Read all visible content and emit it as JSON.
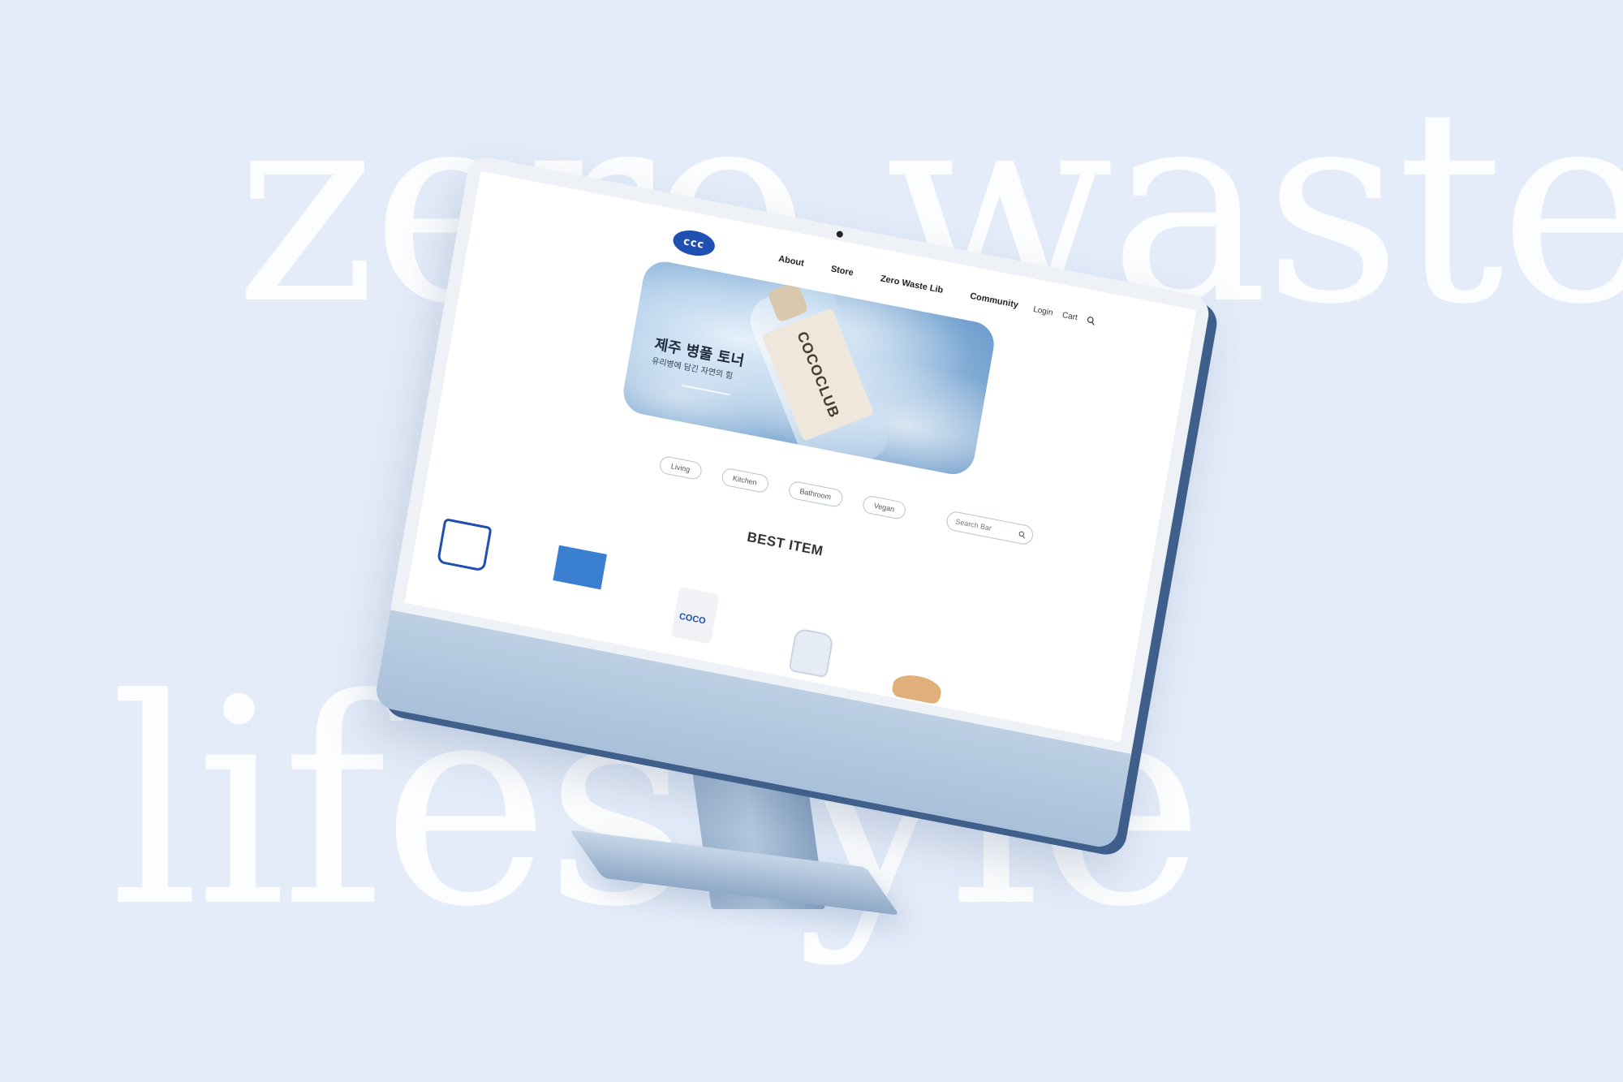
{
  "background": {
    "word_top": "zero waste",
    "word_bottom": "lifestyle"
  },
  "site": {
    "logo_text": "ccc",
    "brand_color": "#1f4fb0",
    "nav": {
      "about": "About",
      "store": "Store",
      "zero_waste_lib": "Zero Waste Lib",
      "community": "Community"
    },
    "util": {
      "login": "Login",
      "cart": "Cart",
      "search_icon": "search-icon"
    },
    "hero": {
      "title": "제주 병풀 토너",
      "subtitle": "유리병에 담긴 자연의 힘",
      "product_brand": "COCOCLUB"
    },
    "categories": [
      "Living",
      "Kitchen",
      "Bathroom",
      "Vegan"
    ],
    "search": {
      "placeholder": "Search Bar"
    },
    "best_item_title": "BEST ITEM",
    "product_bag_label": "COCO"
  }
}
